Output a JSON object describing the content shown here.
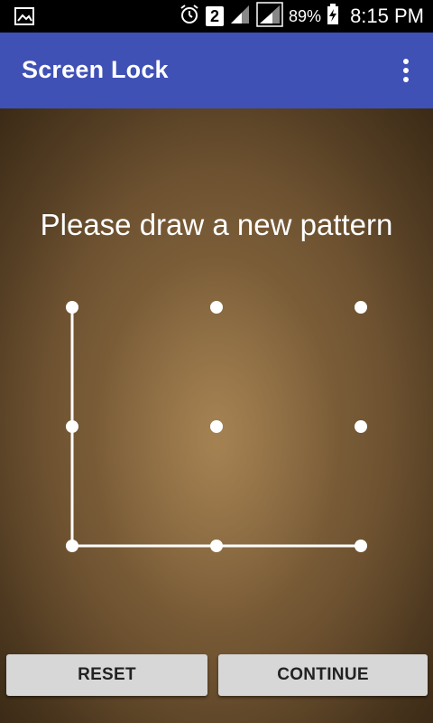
{
  "status_bar": {
    "sim_label": "2",
    "battery": "89%",
    "time": "8:15 PM",
    "icons": [
      "image-notification-icon",
      "alarm-icon",
      "sim-2-icon",
      "signal-icon",
      "signal-icon",
      "battery-charging-icon"
    ]
  },
  "app_bar": {
    "title": "Screen Lock",
    "menu_icon": "overflow-menu-icon",
    "color": "#3f51b5"
  },
  "lock": {
    "prompt": "Please draw a new pattern",
    "grid_size": 3,
    "selected_path": [
      0,
      3,
      6,
      7,
      8
    ]
  },
  "buttons": {
    "reset": "RESET",
    "continue": "CONTINUE"
  }
}
